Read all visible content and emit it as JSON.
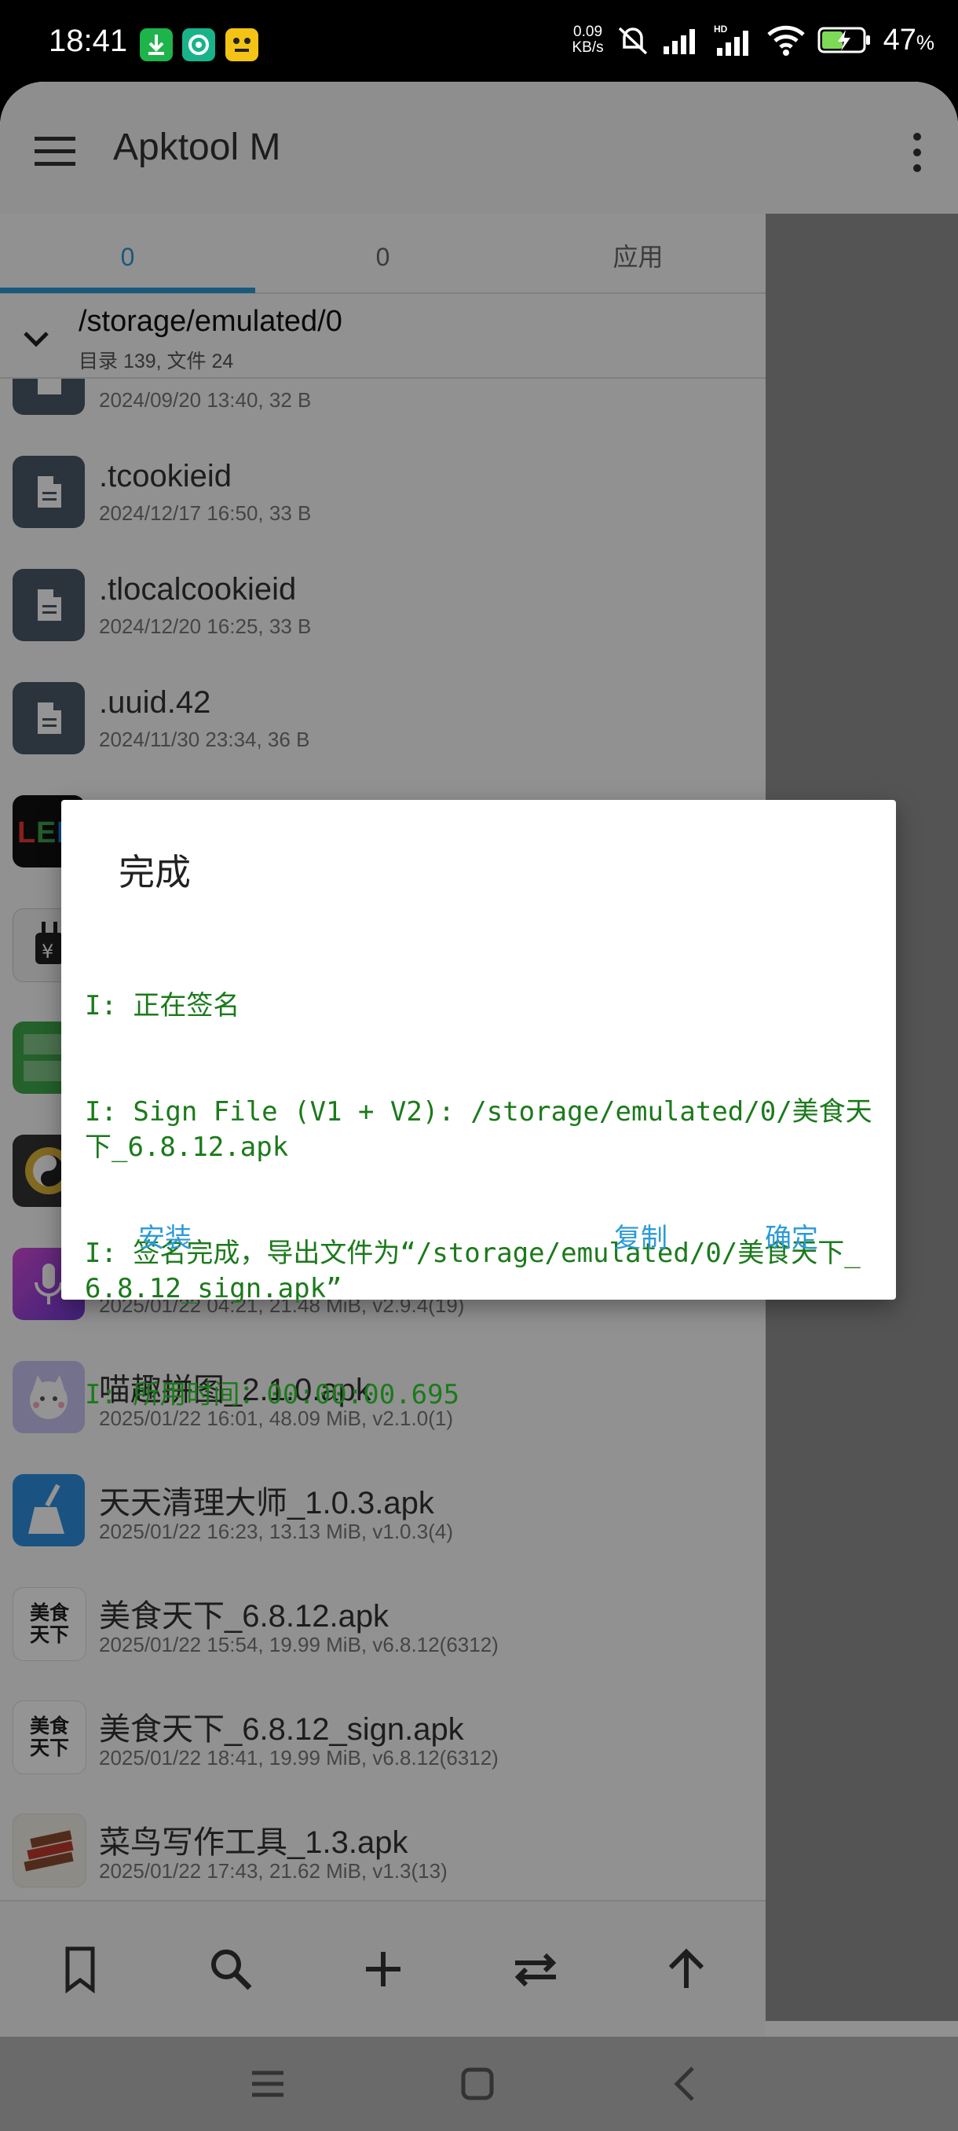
{
  "status_bar": {
    "time": "18:41",
    "speed_value": "0.09",
    "speed_unit": "KB/s",
    "battery_percent": "47",
    "battery_unit": "%"
  },
  "toolbar": {
    "title": "Apktool M"
  },
  "tabs": [
    {
      "label": "0"
    },
    {
      "label": "0"
    },
    {
      "label": "应用"
    }
  ],
  "path": {
    "current": "/storage/emulated/0",
    "summary": "目录 139, 文件 24"
  },
  "files": [
    {
      "name": "",
      "meta": "2024/09/20 13:40, 32 B",
      "icon": "file-icon"
    },
    {
      "name": ".tcookieid",
      "meta": "2024/12/17 16:50, 33 B",
      "icon": "file-icon"
    },
    {
      "name": ".tlocalcookieid",
      "meta": "2024/12/20 16:25, 33 B",
      "icon": "file-icon"
    },
    {
      "name": ".uuid.42",
      "meta": "2024/11/30 23:34, 36 B",
      "icon": "file-icon"
    },
    {
      "name": "",
      "meta": "",
      "icon": "led-app-icon"
    },
    {
      "name": "",
      "meta": "",
      "icon": "charger-app-icon"
    },
    {
      "name": "",
      "meta": "",
      "icon": "ringtone-app-icon"
    },
    {
      "name": "",
      "meta": "",
      "icon": "taiji-app-icon"
    },
    {
      "name": "",
      "meta": "2025/01/22 04:21, 21.48 MiB, v2.9.4(19)",
      "icon": "mic-app-icon"
    },
    {
      "name": "喵趣拼图_2.1.0.apk",
      "meta": "2025/01/22 16:01, 48.09 MiB, v2.1.0(1)",
      "icon": "puzzle-app-icon"
    },
    {
      "name": "天天清理大师_1.0.3.apk",
      "meta": "2025/01/22 16:23, 13.13 MiB, v1.0.3(4)",
      "icon": "broom-app-icon"
    },
    {
      "name": "美食天下_6.8.12.apk",
      "meta": "2025/01/22 15:54, 19.99 MiB, v6.8.12(6312)",
      "icon": "meishi-app-icon",
      "icon_text": "美食天下"
    },
    {
      "name": "美食天下_6.8.12_sign.apk",
      "meta": "2025/01/22 18:41, 19.99 MiB, v6.8.12(6312)",
      "icon": "meishi-app-icon",
      "icon_text": "美食天下"
    },
    {
      "name": "菜鸟写作工具_1.3.apk",
      "meta": "2025/01/22 17:43, 21.62 MiB, v1.3(13)",
      "icon": "book-app-icon"
    }
  ],
  "dialog": {
    "title": "完成",
    "log": [
      "I: 正在签名",
      "I: Sign File (V1 + V2): /storage/emulated/0/美食天下_6.8.12.apk",
      "I: 签名完成，导出文件为“/storage/emulated/0/美食天下_6.8.12_sign.apk”",
      "I: 所用时间：00:00:00.695"
    ],
    "install_label": "安装",
    "copy_label": "复制",
    "ok_label": "确定"
  },
  "colors": {
    "accent": "#2b9ad6",
    "log_text": "#1b7a1b",
    "file_icon_bg": "#4a5968"
  }
}
